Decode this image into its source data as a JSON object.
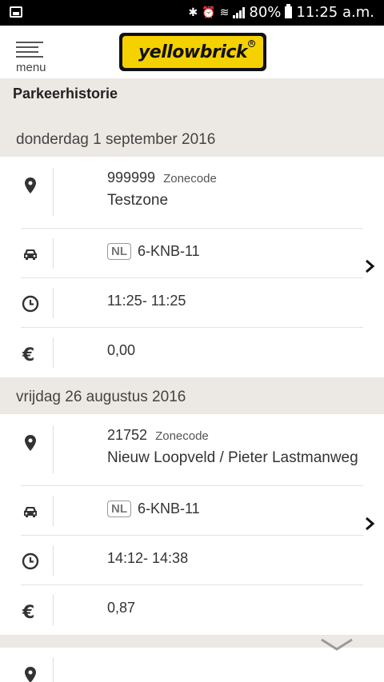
{
  "status_bar": {
    "battery": "80%",
    "time": "11:25 a.m.",
    "icons": [
      "image-icon",
      "bluetooth-icon",
      "alarm-icon",
      "wifi-icon",
      "signal-icon",
      "battery-icon"
    ]
  },
  "header": {
    "menu_label": "menu",
    "logo_text": "yellowbrick",
    "logo_mark": "R"
  },
  "page": {
    "title": "Parkeerhistorie"
  },
  "colors": {
    "accent": "#f6d100",
    "section_bg": "#ece9e4"
  },
  "entries": [
    {
      "date": "donderdag 1 september 2016",
      "zone_code": "999999",
      "zone_code_label": "Zonecode",
      "zone_name": "Testzone",
      "country": "NL",
      "plate": "6-KNB-11",
      "time": "11:25- 11:25",
      "cost": "0,00"
    },
    {
      "date": "vrijdag 26 augustus 2016",
      "zone_code": "21752",
      "zone_code_label": "Zonecode",
      "zone_name": "Nieuw Loopveld / Pieter Lastmanweg",
      "country": "NL",
      "plate": "6-KNB-11",
      "time": "14:12- 14:38",
      "cost": "0,87"
    }
  ]
}
